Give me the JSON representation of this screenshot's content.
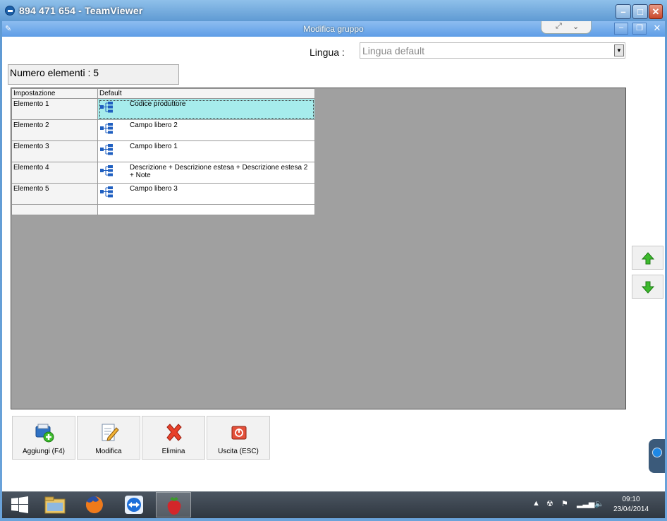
{
  "teamviewer": {
    "title": "894 471 654 - TeamViewer"
  },
  "app": {
    "title": "Modifica gruppo"
  },
  "lingua": {
    "label": "Lingua :",
    "value": "Lingua default"
  },
  "count_label": "Numero elementi : 5",
  "grid": {
    "columns": [
      "Impostazione",
      "Default"
    ],
    "rows": [
      {
        "name": "Elemento 1",
        "value": "Codice produttore",
        "selected": true
      },
      {
        "name": "Elemento 2",
        "value": "Campo libero 2",
        "selected": false
      },
      {
        "name": "Elemento 3",
        "value": "Campo libero 1",
        "selected": false
      },
      {
        "name": "Elemento 4",
        "value": "Descrizione + Descrizione estesa + Descrizione estesa 2 + Note",
        "selected": false
      },
      {
        "name": "Elemento 5",
        "value": "Campo libero 3",
        "selected": false
      }
    ]
  },
  "toolbar": {
    "add_label": "Aggiungi (F4)",
    "edit_label": "Modifica",
    "delete_label": "Elimina",
    "exit_label": "Uscita (ESC)"
  },
  "taskbar": {
    "time": "09:10",
    "date": "23/04/2014"
  },
  "colors": {
    "selected_row": "#a6ecec",
    "grid_background": "#a0a0a0",
    "arrow_green": "#3cba2c"
  }
}
